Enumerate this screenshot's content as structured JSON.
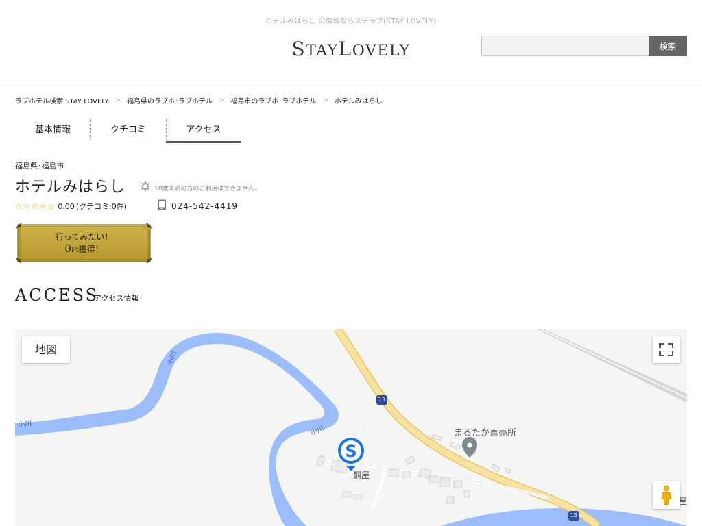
{
  "header": {
    "tagline": "ホテルみはらし の情報ならステラブ(STAY LOVELY)",
    "logo": {
      "s": "S",
      "tay": "TAY",
      "l": "L",
      "ovely": "OVELY"
    },
    "search": {
      "value": "",
      "placeholder": "",
      "button_label": "検索"
    }
  },
  "breadcrumb": [
    "ラブホテル検索 STAY LOVELY",
    "福島県のラブホ･ラブホテル",
    "福島市のラブホ･ラブホテル",
    "ホテルみはらし"
  ],
  "breadcrumb_separator": ">",
  "tabs": [
    {
      "label": "基本情報",
      "active": false
    },
    {
      "label": "クチコミ",
      "active": false
    },
    {
      "label": "アクセス",
      "active": true
    }
  ],
  "hotel": {
    "location": "福島県･福島市",
    "name": "ホテルみはらし",
    "age_note": "18歳未満の方のご利用はできません。",
    "stars": "☆☆☆☆☆",
    "rating_value": 0,
    "score": "0.00",
    "review_count": "(クチコミ:0件)",
    "phone": "024-542-4419"
  },
  "wish_button": {
    "line1": "行ってみたい！",
    "points": "0",
    "points_unit": "Pt",
    "line2_suffix": "獲得！"
  },
  "access": {
    "title": "ACCESS",
    "subtitle": "アクセス情報"
  },
  "map": {
    "type_button": "地図",
    "labels": {
      "shop": "まるたか直売所",
      "place": "銅屋",
      "edge": "屋"
    },
    "river_labels": [
      "小川",
      "小川",
      "小川"
    ],
    "route_numbers": [
      "13",
      "13"
    ],
    "icons": {
      "fullscreen": "fullscreen-icon",
      "pegman": "pegman-icon",
      "hotel_marker": "hotel-marker-icon",
      "poi_marker": "poi-marker-icon"
    },
    "colors": {
      "water": "#9bbdfb",
      "road": "#f8e2a0",
      "road_edge": "#e8c56a",
      "land": "#f5f5f3",
      "marker": "#1a73e8"
    }
  }
}
